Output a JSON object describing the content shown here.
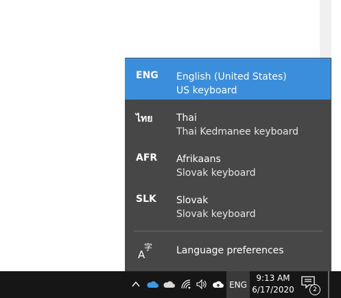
{
  "flyout": {
    "languages": [
      {
        "abbr": "ENG",
        "name": "English (United States)",
        "keyboard": "US keyboard",
        "selected": true
      },
      {
        "abbr": "ไทย",
        "name": "Thai",
        "keyboard": "Thai Kedmanee keyboard",
        "selected": false
      },
      {
        "abbr": "AFR",
        "name": "Afrikaans",
        "keyboard": "Slovak keyboard",
        "selected": false
      },
      {
        "abbr": "SLK",
        "name": "Slovak",
        "keyboard": "Slovak keyboard",
        "selected": false
      }
    ],
    "preferences_label": "Language preferences",
    "preferences_icon": "language-preferences-icon"
  },
  "taskbar": {
    "tray_icons": [
      "chevron-up-icon",
      "onedrive-blue-icon",
      "onedrive-white-icon",
      "wifi-icon",
      "volume-icon",
      "cloud-upload-icon"
    ],
    "input_indicator": "ENG",
    "time": "9:13 AM",
    "date": "6/17/2020",
    "notification_count": "2"
  },
  "colors": {
    "accent": "#3b8edb",
    "flyout_bg": "#474747",
    "taskbar_bg": "#161616",
    "onedrive_blue": "#3c9be6"
  }
}
